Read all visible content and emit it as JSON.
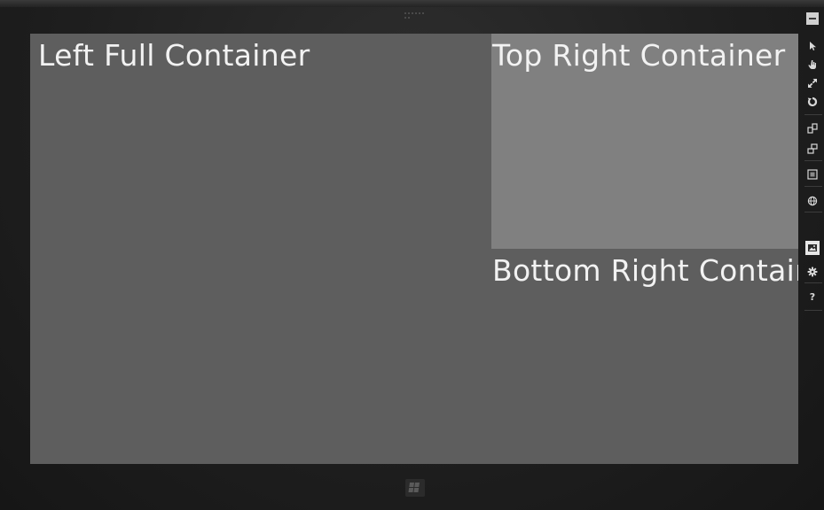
{
  "containers": {
    "left": {
      "label": "Left Full Container"
    },
    "top_right": {
      "label": "Top Right Container"
    },
    "bottom_right": {
      "label": "Bottom Right Container"
    }
  },
  "toolbar": {
    "items": [
      {
        "name": "minimize",
        "icon": "minimize-icon"
      },
      {
        "name": "pointer",
        "icon": "cursor-icon"
      },
      {
        "name": "touch",
        "icon": "hand-icon"
      },
      {
        "name": "pinch-zoom",
        "icon": "pinch-icon"
      },
      {
        "name": "rotate",
        "icon": "rotate-icon"
      },
      {
        "name": "rotate-clockwise",
        "icon": "rotate-cw-icon"
      },
      {
        "name": "rotate-counterclockwise",
        "icon": "rotate-ccw-icon"
      },
      {
        "name": "resolution",
        "icon": "resolution-icon"
      },
      {
        "name": "location",
        "icon": "globe-icon"
      },
      {
        "name": "screenshot",
        "icon": "camera-image-icon"
      },
      {
        "name": "settings",
        "icon": "gear-icon"
      },
      {
        "name": "help",
        "icon": "help-icon",
        "label": "?"
      }
    ]
  },
  "colors": {
    "screen_bg": "#5e5e5e",
    "top_right_bg": "#808080",
    "label_text": "#f2f2f2",
    "frame": "#1f1f1f"
  }
}
